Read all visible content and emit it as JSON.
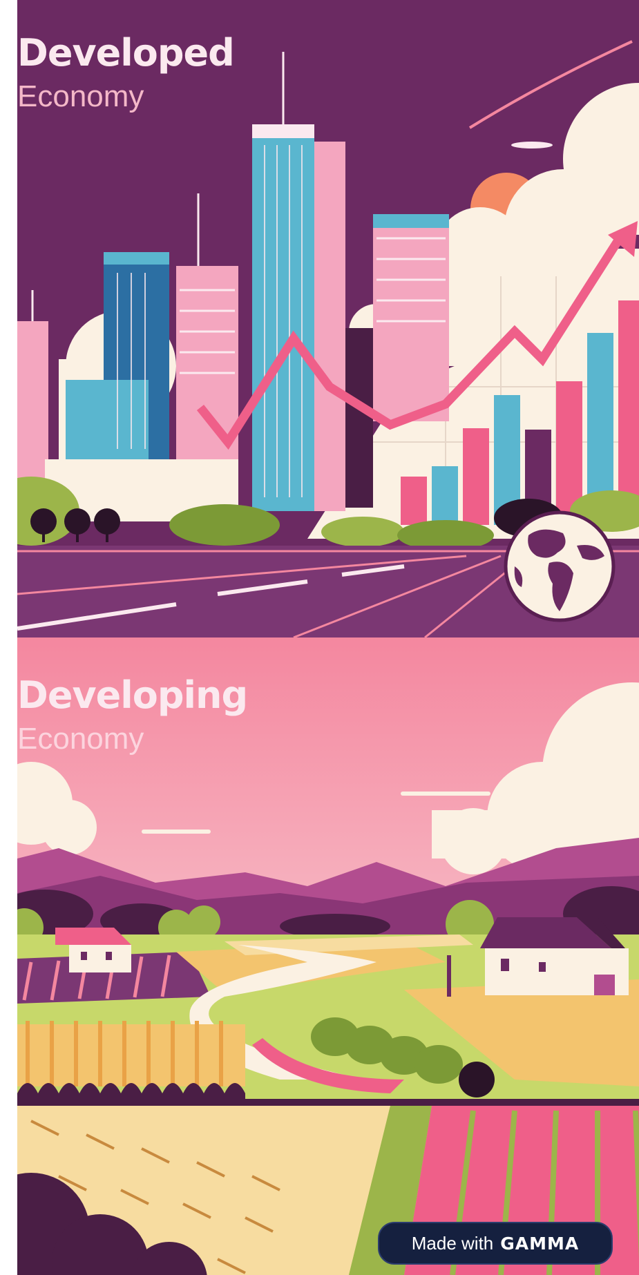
{
  "top_panel": {
    "title": "Developed",
    "subtitle": "Economy"
  },
  "bottom_panel": {
    "title": "Developing",
    "subtitle": "Economy"
  },
  "badge": {
    "prefix": "Made with",
    "brand": "GAMMA"
  },
  "colors": {
    "plum": "#6b2a62",
    "pink": "#f4879f",
    "hot_pink": "#ef5f89",
    "teal": "#5ab6cf",
    "cream": "#fbf1e3",
    "green": "#9cb54a",
    "badge_bg": "#15203f"
  }
}
